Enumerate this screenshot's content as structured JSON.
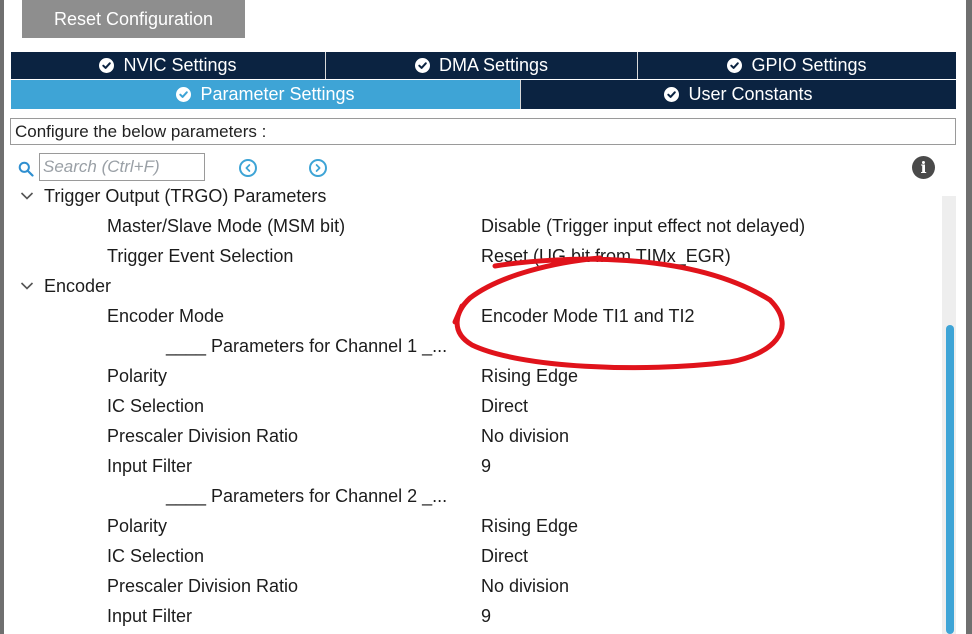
{
  "toolbar": {
    "reset_label": "Reset Configuration"
  },
  "tabs": {
    "row1": [
      {
        "label": "NVIC Settings",
        "active": false
      },
      {
        "label": "DMA Settings",
        "active": false
      },
      {
        "label": "GPIO Settings",
        "active": false
      }
    ],
    "row2": [
      {
        "label": "Parameter Settings",
        "active": true
      },
      {
        "label": "User Constants",
        "active": false
      }
    ]
  },
  "configure": {
    "text": "Configure the below parameters :"
  },
  "search": {
    "placeholder": "Search (Ctrl+F)",
    "value": ""
  },
  "icons": {
    "search": "search-icon",
    "prev": "previous-result-icon",
    "next": "next-result-icon",
    "info": "info-icon",
    "tab_check": "check-circle-icon",
    "expand": "chevron-down-icon"
  },
  "groups": {
    "trgo": {
      "label": "Trigger Output (TRGO) Parameters"
    },
    "encoder": {
      "label": "Encoder"
    }
  },
  "params": {
    "msm": {
      "name": "Master/Slave Mode (MSM bit)",
      "value": "Disable (Trigger input effect not delayed)"
    },
    "tes": {
      "name": "Trigger Event Selection",
      "value": "Reset (UG bit from TIMx_EGR)"
    },
    "enc_mode": {
      "name": "Encoder Mode",
      "value": "Encoder Mode TI1 and TI2"
    },
    "ch1_header": "____ Parameters for Channel 1 _...",
    "ch1_polarity": {
      "name": "Polarity",
      "value": "Rising Edge"
    },
    "ch1_ic": {
      "name": "IC Selection",
      "value": "Direct"
    },
    "ch1_presc": {
      "name": "Prescaler Division Ratio",
      "value": "No division"
    },
    "ch1_filter": {
      "name": "Input Filter",
      "value": "9"
    },
    "ch2_header": "____ Parameters for Channel 2 _...",
    "ch2_polarity": {
      "name": "Polarity",
      "value": "Rising Edge"
    },
    "ch2_ic": {
      "name": "IC Selection",
      "value": "Direct"
    },
    "ch2_presc": {
      "name": "Prescaler Division Ratio",
      "value": "No division"
    },
    "ch2_filter": {
      "name": "Input Filter",
      "value": "9"
    }
  },
  "colors": {
    "tab_dark": "#0b2341",
    "tab_active": "#3ea4d6",
    "annotation": "#e0131b",
    "button_gray": "#8e8e8e"
  }
}
